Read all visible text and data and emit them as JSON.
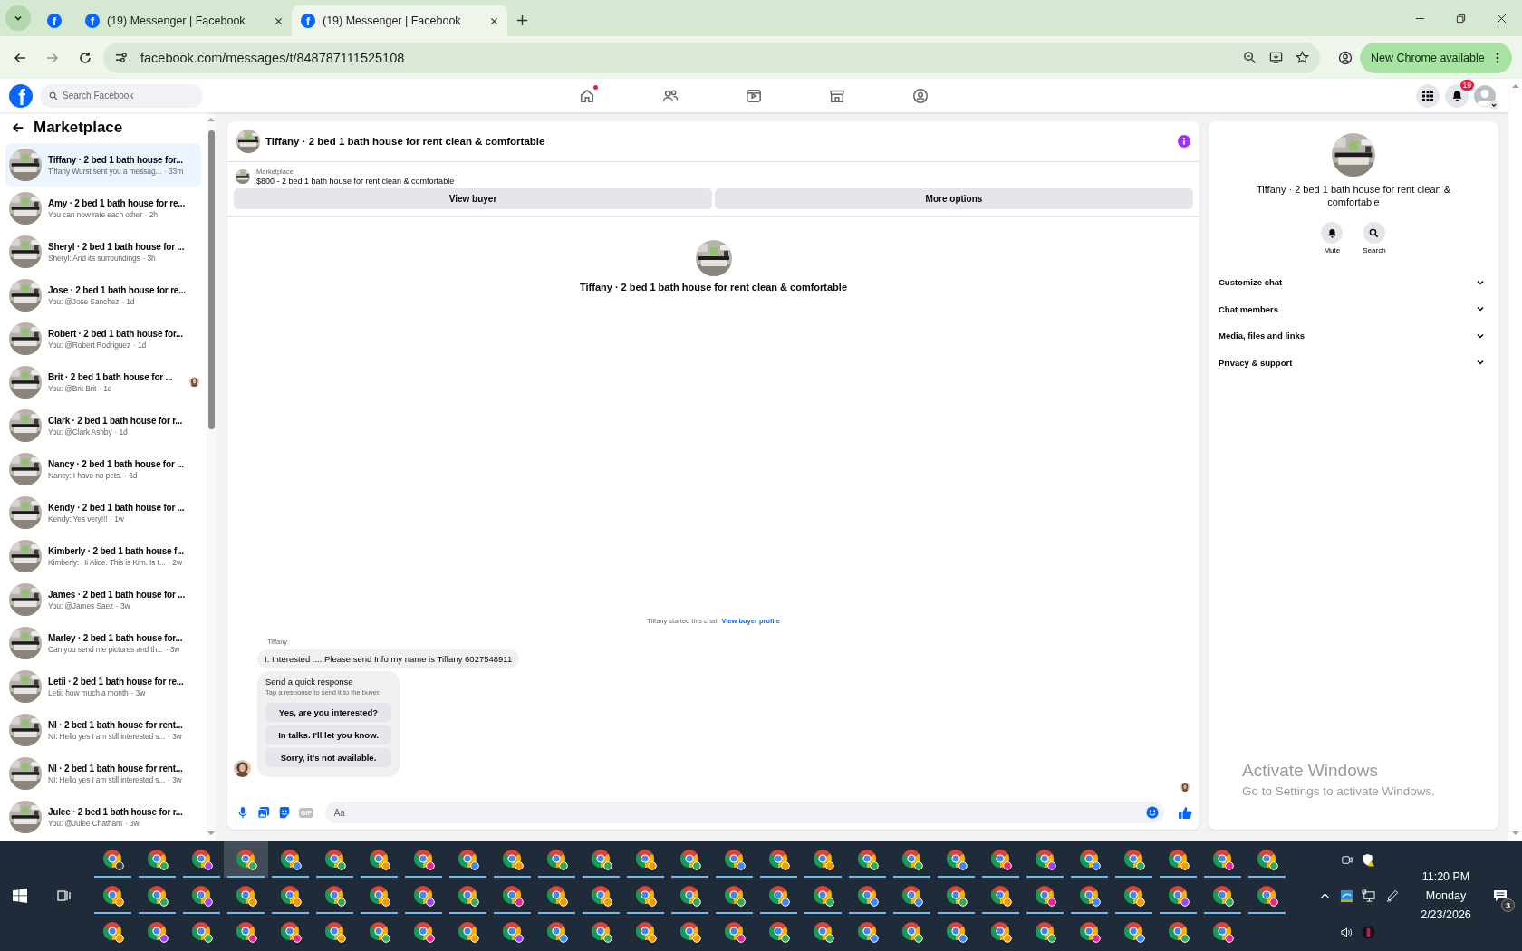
{
  "browser": {
    "pinned_tab": {
      "favicon": "f"
    },
    "tabs": [
      {
        "favicon": "f",
        "title": "(19) Messenger | Facebook",
        "selected": false
      },
      {
        "favicon": "f",
        "title": "(19) Messenger | Facebook",
        "selected": true
      }
    ],
    "url": "facebook.com/messages/t/848787111525108",
    "update_button": "New Chrome available"
  },
  "facebook": {
    "logo": "f",
    "search_placeholder": "Search Facebook",
    "nav": [
      {
        "kind": "home",
        "dot": true
      },
      {
        "kind": "friends",
        "dot": false
      },
      {
        "kind": "video",
        "dot": false
      },
      {
        "kind": "marketplace",
        "dot": false
      },
      {
        "kind": "groups",
        "dot": false
      }
    ],
    "notification_count": "19"
  },
  "sidebar": {
    "title": "Marketplace",
    "items": [
      {
        "title": "Tiffany · 2 bed 1 bath house for...",
        "preview": "Tiffany Wurst sent you a messag...",
        "time": "· 33m",
        "selected": true,
        "read_receipt": false
      },
      {
        "title": "Amy · 2 bed 1 bath house for re...",
        "preview": "You can now rate each other",
        "time": "· 2h",
        "selected": false,
        "read_receipt": false
      },
      {
        "title": "Sheryl · 2 bed 1 bath house for ...",
        "preview": "Sheryl: And its surroundings",
        "time": "· 3h",
        "selected": false,
        "read_receipt": false
      },
      {
        "title": "Jose · 2 bed 1 bath house for re...",
        "preview": "You: @Jose Sanchez",
        "time": "· 1d",
        "selected": false,
        "read_receipt": false
      },
      {
        "title": "Robert · 2 bed 1 bath house for...",
        "preview": "You: @Robert Rodriguez",
        "time": "· 1d",
        "selected": false,
        "read_receipt": false
      },
      {
        "title": "Brit · 2 bed 1 bath house for ...",
        "preview": "You: @Brit Brit",
        "time": "· 1d",
        "selected": false,
        "read_receipt": true
      },
      {
        "title": "Clark · 2 bed 1 bath house for r...",
        "preview": "You: @Clark Ashby",
        "time": "· 1d",
        "selected": false,
        "read_receipt": false
      },
      {
        "title": "Nancy · 2 bed 1 bath house for ...",
        "preview": "Nancy: I have no pets.",
        "time": "· 6d",
        "selected": false,
        "read_receipt": false
      },
      {
        "title": "Kendy · 2 bed 1 bath house for ...",
        "preview": "Kendy: Yes very!!!",
        "time": "· 1w",
        "selected": false,
        "read_receipt": false
      },
      {
        "title": "Kimberly · 2 bed 1 bath house f...",
        "preview": "Kimberly: Hi Alice. This is Kim. Is t...",
        "time": "· 2w",
        "selected": false,
        "read_receipt": false
      },
      {
        "title": "James · 2 bed 1 bath house for ...",
        "preview": "You: @James Saez",
        "time": "· 3w",
        "selected": false,
        "read_receipt": false
      },
      {
        "title": "Marley · 2 bed 1 bath house for...",
        "preview": "Can you send me pictures and th...",
        "time": "· 3w",
        "selected": false,
        "read_receipt": false
      },
      {
        "title": "Letii · 2 bed 1 bath house for re...",
        "preview": "Letii: how much a month",
        "time": "· 3w",
        "selected": false,
        "read_receipt": false
      },
      {
        "title": "NI · 2 bed 1 bath house for rent...",
        "preview": "NI: Hello yes I am still interested s...",
        "time": "· 3w",
        "selected": false,
        "read_receipt": false
      },
      {
        "title": "NI · 2 bed 1 bath house for rent...",
        "preview": "NI: Hello yes I am still interested s...",
        "time": "· 3w",
        "selected": false,
        "read_receipt": false
      },
      {
        "title": "Julee · 2 bed 1 bath house for r...",
        "preview": "You: @Julee Chatham",
        "time": "· 3w",
        "selected": false,
        "read_receipt": false
      }
    ]
  },
  "chat": {
    "title": "Tiffany · 2 bed 1 bath house for rent clean & comfortable",
    "listing_label": "Marketplace",
    "listing": "$800 - 2 bed 1 bath house for rent clean & comfortable",
    "actions": [
      "View buyer",
      "More options"
    ],
    "intro_title": "Tiffany · 2 bed 1 bath house for rent clean & comfortable",
    "started": "Tiffany started this chat.",
    "started_link": "View buyer profile",
    "sender": "Tiffany",
    "message": "I. Interested .... Please send Info my name is Tiffany 6027548911",
    "quick": {
      "title": "Send a quick response",
      "hint": "Tap a response to send it to the buyer.",
      "options": [
        "Yes, are you interested?",
        "In talks. I'll let you know.",
        "Sorry, it's not available."
      ]
    },
    "gif_label": "GIF",
    "composer_placeholder": "Aa"
  },
  "details": {
    "title": "Tiffany · 2 bed 1 bath house for rent clean & comfortable",
    "actions": [
      {
        "kind": "mute",
        "label": "Mute"
      },
      {
        "kind": "search",
        "label": "Search"
      }
    ],
    "sections": [
      {
        "label": "Customize chat",
        "expanded": false
      },
      {
        "label": "Chat members",
        "expanded": false
      },
      {
        "label": "Media, files and links",
        "expanded": false
      },
      {
        "label": "Privacy & support",
        "expanded": false
      }
    ]
  },
  "os_notice": {
    "title": "Activate Windows",
    "text": "Go to Settings to activate Windows."
  },
  "taskbar": {
    "rows": [
      {
        "open": true,
        "icons": [
          {
            "color": "#3c4043",
            "selected": false
          },
          {
            "color": "#34a853",
            "selected": false
          },
          {
            "color": "#a142f4",
            "selected": false
          },
          {
            "color": "#34a853",
            "selected": true
          },
          {
            "color": "#4285f4",
            "selected": false
          },
          {
            "color": "#34a853",
            "selected": false
          },
          {
            "color": "#f29900",
            "selected": false
          },
          {
            "color": "#e52592",
            "selected": false
          },
          {
            "color": "#4285f4",
            "selected": false
          },
          {
            "color": "#f29900",
            "selected": false
          },
          {
            "color": "#34a853",
            "selected": false
          },
          {
            "color": "#34a853",
            "selected": false
          },
          {
            "color": "#f29900",
            "selected": false
          },
          {
            "color": "#34a853",
            "selected": false
          },
          {
            "color": "#4285f4",
            "selected": false
          },
          {
            "color": "#f29900",
            "selected": false
          },
          {
            "color": "#f29900",
            "selected": false
          },
          {
            "color": "#34a853",
            "selected": false
          },
          {
            "color": "#34a853",
            "selected": false
          },
          {
            "color": "#4285f4",
            "selected": false
          },
          {
            "color": "#e52592",
            "selected": false
          },
          {
            "color": "#a142f4",
            "selected": false
          },
          {
            "color": "#4285f4",
            "selected": false
          },
          {
            "color": "#34a853",
            "selected": false
          },
          {
            "color": "#f29900",
            "selected": false
          },
          {
            "color": "#e52592",
            "selected": false
          },
          {
            "color": "#34a853",
            "selected": false
          }
        ]
      },
      {
        "open": true,
        "icons": [
          {
            "color": "#f29900",
            "selected": false
          },
          {
            "color": "#34a853",
            "selected": false
          },
          {
            "color": "#a142f4",
            "selected": false
          },
          {
            "color": "#f29900",
            "selected": false
          },
          {
            "color": "#f29900",
            "selected": false
          },
          {
            "color": "#34a853",
            "selected": false
          },
          {
            "color": "#f29900",
            "selected": false
          },
          {
            "color": "#a142f4",
            "selected": false
          },
          {
            "color": "#34a853",
            "selected": false
          },
          {
            "color": "#e52592",
            "selected": false
          },
          {
            "color": "#f29900",
            "selected": false
          },
          {
            "color": "#f29900",
            "selected": false
          },
          {
            "color": "#f29900",
            "selected": false
          },
          {
            "color": "#34a853",
            "selected": false
          },
          {
            "color": "#34a853",
            "selected": false
          },
          {
            "color": "#4285f4",
            "selected": false
          },
          {
            "color": "#34a853",
            "selected": false
          },
          {
            "color": "#4285f4",
            "selected": false
          },
          {
            "color": "#4285f4",
            "selected": false
          },
          {
            "color": "#34a853",
            "selected": false
          },
          {
            "color": "#f29900",
            "selected": false
          },
          {
            "color": "#e52592",
            "selected": false
          },
          {
            "color": "#4285f4",
            "selected": false
          },
          {
            "color": "#f29900",
            "selected": false
          },
          {
            "color": "#a142f4",
            "selected": false
          },
          {
            "color": "#34a853",
            "selected": false
          },
          {
            "color": "#e52592",
            "selected": false
          }
        ]
      },
      {
        "open": false,
        "icons": [
          {
            "color": "#f29900",
            "selected": false
          },
          {
            "color": "#a142f4",
            "selected": false
          },
          {
            "color": "#34a853",
            "selected": false
          },
          {
            "color": "#e52592",
            "selected": false
          },
          {
            "color": "#e52592",
            "selected": false
          },
          {
            "color": "#f29900",
            "selected": false
          },
          {
            "color": "#34a853",
            "selected": false
          },
          {
            "color": "#e52592",
            "selected": false
          },
          {
            "color": "#f29900",
            "selected": false
          },
          {
            "color": "#a142f4",
            "selected": false
          },
          {
            "color": "#4285f4",
            "selected": false
          },
          {
            "color": "#34a853",
            "selected": false
          },
          {
            "color": "#f29900",
            "selected": false
          },
          {
            "color": "#f29900",
            "selected": false
          },
          {
            "color": "#e52592",
            "selected": false
          },
          {
            "color": "#34a853",
            "selected": false
          },
          {
            "color": "#34a853",
            "selected": false
          },
          {
            "color": "#4285f4",
            "selected": false
          },
          {
            "color": "#34a853",
            "selected": false
          },
          {
            "color": "#4285f4",
            "selected": false
          },
          {
            "color": "#f29900",
            "selected": false
          },
          {
            "color": "#34a853",
            "selected": false
          },
          {
            "color": "#e52592",
            "selected": false
          },
          {
            "color": "#4285f4",
            "selected": false
          },
          {
            "color": "#34a853",
            "selected": false
          },
          {
            "color": "#e52592",
            "selected": false
          }
        ]
      }
    ],
    "clock": {
      "time": "11:20 PM",
      "day": "Monday",
      "date": "2/23/2026"
    },
    "notification_count": "3"
  }
}
